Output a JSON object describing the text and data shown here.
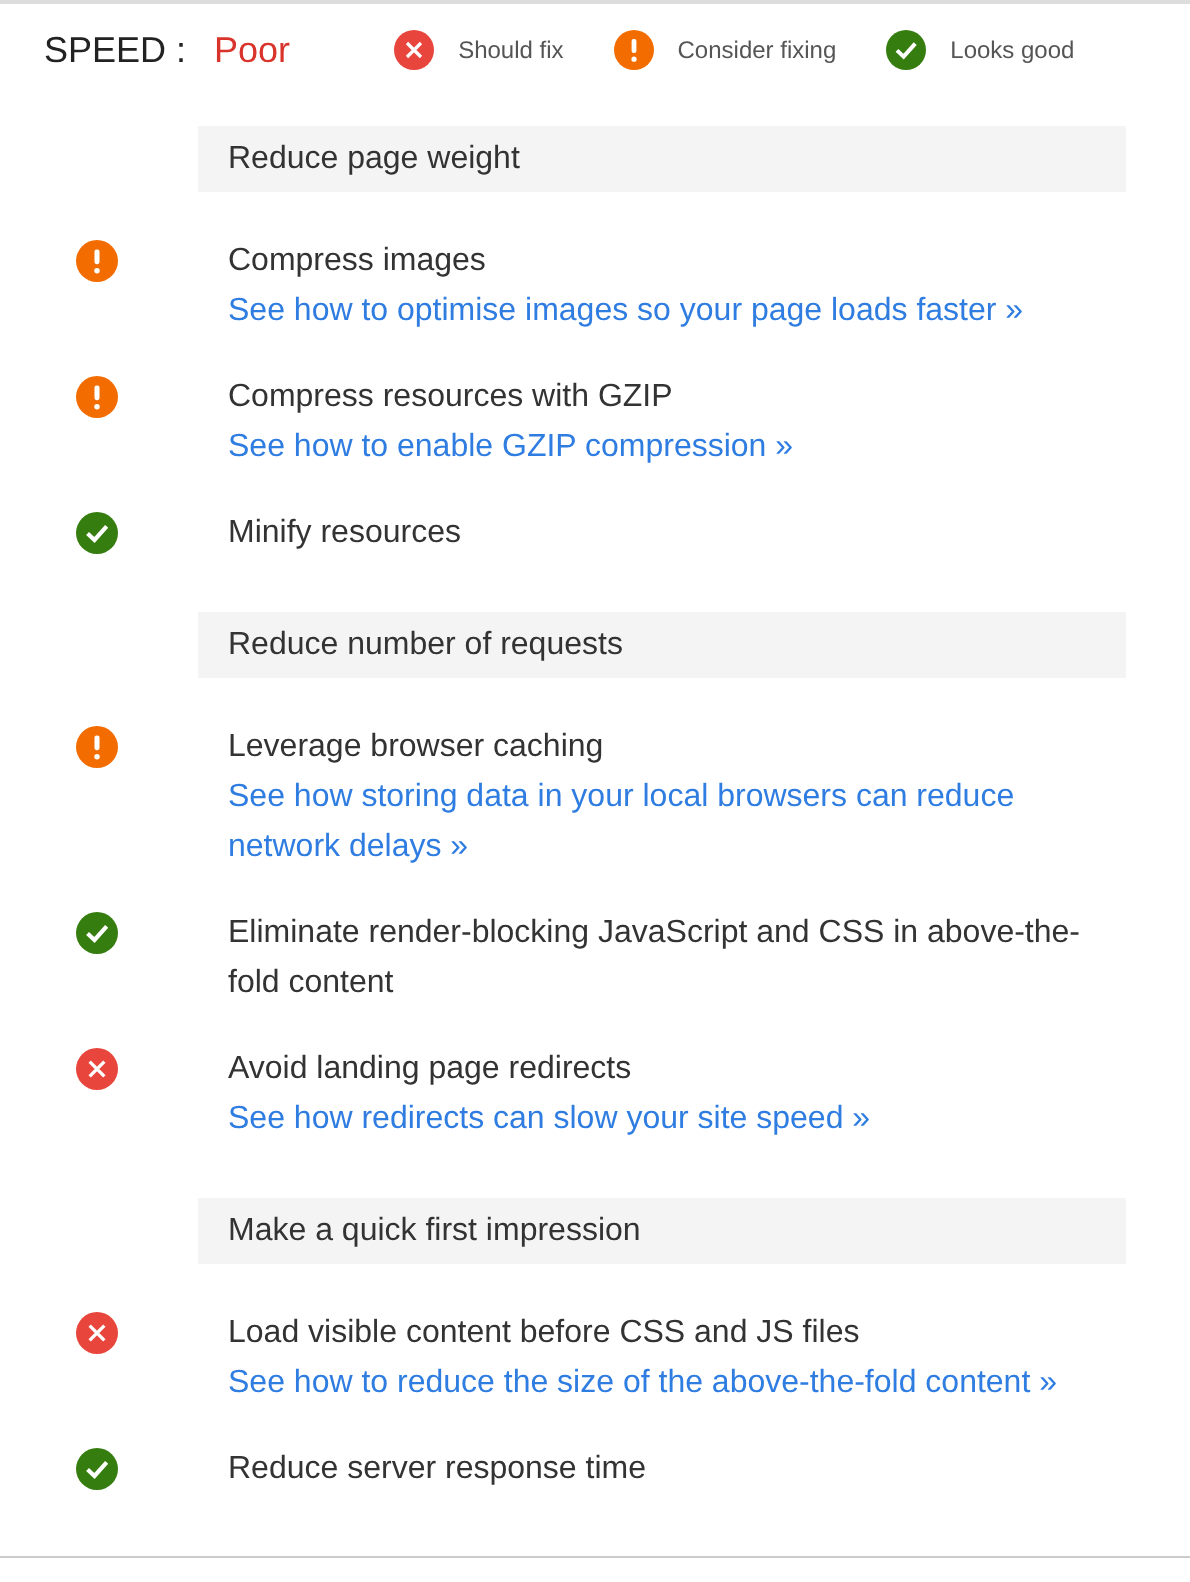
{
  "header": {
    "label": "SPEED :",
    "rating": "Poor"
  },
  "legend": [
    {
      "kind": "fix",
      "label": "Should fix"
    },
    {
      "kind": "consider",
      "label": "Consider fixing"
    },
    {
      "kind": "good",
      "label": "Looks good"
    }
  ],
  "sections": [
    {
      "title": "Reduce page weight",
      "items": [
        {
          "kind": "consider",
          "title": "Compress images",
          "link": "See how to optimise images so your page loads faster »"
        },
        {
          "kind": "consider",
          "title": "Compress resources with GZIP",
          "link": "See how to enable GZIP compression »"
        },
        {
          "kind": "good",
          "title": "Minify resources"
        }
      ]
    },
    {
      "title": "Reduce number of requests",
      "items": [
        {
          "kind": "consider",
          "title": "Leverage browser caching",
          "link": "See how storing data in your local browsers can reduce network delays »"
        },
        {
          "kind": "good",
          "title": "Eliminate render-blocking JavaScript and CSS in above-the-fold content"
        },
        {
          "kind": "fix",
          "title": "Avoid landing page redirects",
          "link": "See how redirects can slow your site speed »"
        }
      ]
    },
    {
      "title": "Make a quick first impression",
      "items": [
        {
          "kind": "fix",
          "title": "Load visible content before CSS and JS files",
          "link": "See how to reduce the size of the above-the-fold content »"
        },
        {
          "kind": "good",
          "title": "Reduce server response time"
        }
      ]
    }
  ]
}
